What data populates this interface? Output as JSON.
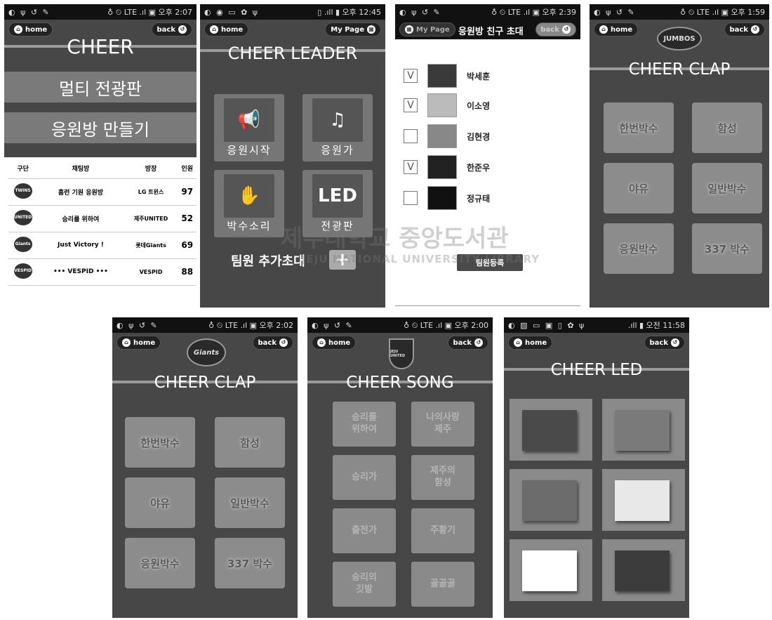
{
  "common": {
    "home": "home",
    "back": "back"
  },
  "s1": {
    "status_left": "◐ ψ ↺ ✎",
    "status_right": "♁ ⏲ LTE .ıl ▣ 오후 2:07",
    "title": "CHEER",
    "btn1": "멀티 전광판",
    "btn2": "응원방 만들기",
    "headers": [
      "구단",
      "채팅방",
      "방장",
      "인원"
    ],
    "rows": [
      {
        "logo": "TWINS",
        "room": "홈런 기원 응원방",
        "owner": "LG 트윈스",
        "count": "97"
      },
      {
        "logo": "UNITED",
        "room": "승리를 위하여",
        "owner": "제주UNITED",
        "count": "52"
      },
      {
        "logo": "Giants",
        "room": "Just Victory !",
        "owner": "롯데Giants",
        "count": "69"
      },
      {
        "logo": "VESPID",
        "room": "••• VESPID •••",
        "owner": "VESPID",
        "count": "88"
      }
    ]
  },
  "s2": {
    "status_left": "◐ ◉ ▭ ✿ ψ",
    "status_right": "▯ .ıll ▮ 오후 12:45",
    "mypage": "My Page",
    "title": "CHEER LEADER",
    "b1": "응원시작",
    "b2": "응원가",
    "b3": "박수소리",
    "b4": "전광판",
    "b4_icon": "LED",
    "invite": "팀원 추가초대",
    "plus": "+"
  },
  "s3": {
    "status_left": "◐ ψ ↺ ✎",
    "status_right": "♁ ⏲ LTE .ıl ▣ 오후 2:39",
    "mypage": "My Page",
    "title": "응원방 친구 초대",
    "friends": [
      {
        "name": "박세훈",
        "checked": "V"
      },
      {
        "name": "이소영",
        "checked": "V"
      },
      {
        "name": "김현경",
        "checked": ""
      },
      {
        "name": "한준우",
        "checked": "V"
      },
      {
        "name": "정규태",
        "checked": ""
      }
    ],
    "register": "팀원등록"
  },
  "s4": {
    "status_left": "◐ ψ ↺ ✎",
    "status_right": "♁ ⏲ LTE .ıl ▣ 오후 1:59",
    "logo": "JUMBOS",
    "title": "CHEER CLAP",
    "buttons": [
      "한번박수",
      "함성",
      "야유",
      "일반박수",
      "응원박수",
      "337 박수"
    ]
  },
  "s5": {
    "status_left": "◐ ψ ↺ ✎",
    "status_right": "♁ ⏲ LTE .ıl ▣ 오후 2:02",
    "logo": "Giants",
    "title": "CHEER CLAP",
    "buttons": [
      "한번박수",
      "함성",
      "야유",
      "일반박수",
      "응원박수",
      "337 박수"
    ]
  },
  "s6": {
    "status_left": "◐ ψ ↺ ✎",
    "status_right": "♁ ⏲ LTE .ıl ▣ 오후 2:00",
    "logo": "JEJU UNITED",
    "title": "CHEER SONG",
    "buttons": [
      "승리를\n위하여",
      "나의사랑\n제주",
      "승리가",
      "제주의\n함성",
      "출전가",
      "주황기",
      "승리의\n깃발",
      "골골골"
    ]
  },
  "s7": {
    "status_left": "◐ ▨ ▭ ▣ ▯ ✿ ψ",
    "status_right": ".ıll ▮ 오전 11:58",
    "title": "CHEER LED",
    "colors": [
      "#4a4a4a",
      "#7a7a7a",
      "#6c6c6c",
      "#e8e8e8",
      "#ffffff",
      "#3c3c3c"
    ]
  },
  "watermark": {
    "ko": "제주대학교 중앙도서관",
    "en": "JEJU NATIONAL UNIVERSITY LIBRARY"
  }
}
